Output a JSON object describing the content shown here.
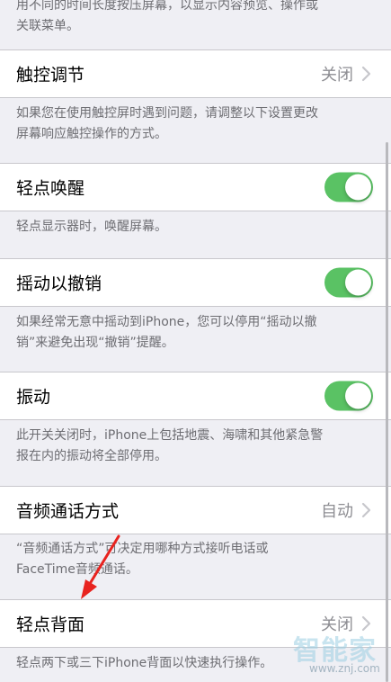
{
  "top_footer": {
    "line1": "用不同的时间长度按压屏幕，以显示内容预览、操作或",
    "line2": "关联菜单。"
  },
  "touch_accommodations": {
    "label": "触控调节",
    "value": "关闭",
    "footer_line1": "如果您在使用触控屏时遇到问题，请调整以下设置更改",
    "footer_line2": "屏幕响应触控操作的方式。"
  },
  "tap_to_wake": {
    "label": "轻点唤醒",
    "enabled": true,
    "footer": "轻点显示器时，唤醒屏幕。"
  },
  "shake_to_undo": {
    "label": "摇动以撤销",
    "enabled": true,
    "footer_line1": "如果经常无意中摇动到iPhone，您可以停用“摇动以撤",
    "footer_line2": "销”来避免出现“撤销”提醒。"
  },
  "vibration": {
    "label": "振动",
    "enabled": true,
    "footer_line1": "此开关关闭时，iPhone上包括地震、海啸和其他紧急警",
    "footer_line2": "报在内的振动将全部停用。"
  },
  "call_audio_routing": {
    "label": "音频通话方式",
    "value": "自动",
    "footer_line1": "“音频通话方式”可决定用哪种方式接听电话或",
    "footer_line2": "FaceTime音频通话。"
  },
  "back_tap": {
    "label": "轻点背面",
    "value": "关闭",
    "footer": "轻点两下或三下iPhone背面以快速执行操作。"
  },
  "watermark": {
    "brand": "智能家",
    "url": "www.znj.com"
  },
  "colors": {
    "background": "#efeff4",
    "switch_on": "#5ac264",
    "annotation_arrow": "#e8231f",
    "secondary_text": "#8e8e93",
    "footer_text": "#6d6d72"
  }
}
